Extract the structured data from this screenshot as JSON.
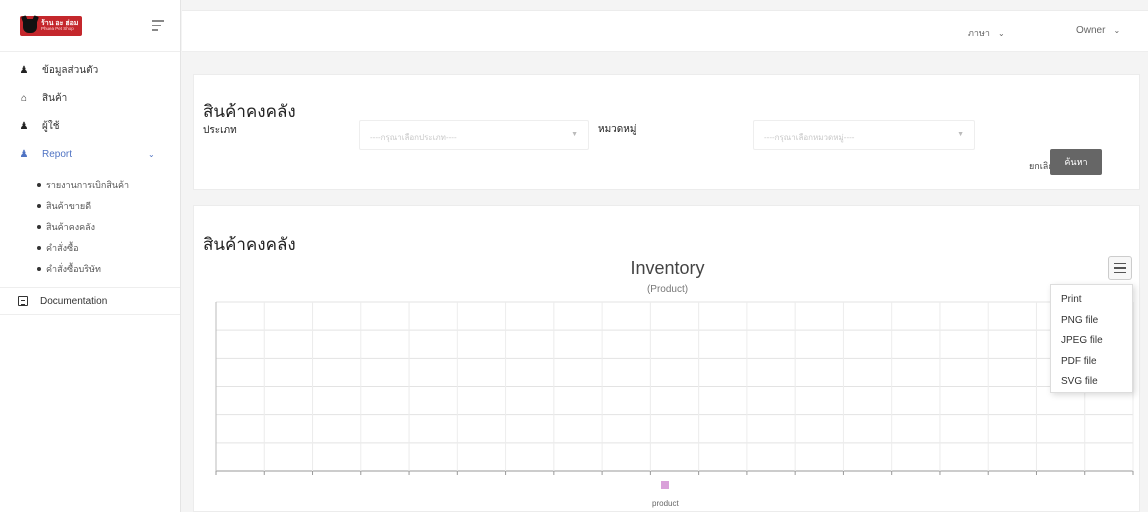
{
  "brand": {
    "logo_line1": "ร้าน อะ ฮ่อม",
    "logo_line2": "Phuea Pet Shop"
  },
  "sidebar": {
    "items": [
      {
        "label": "ข้อมูลส่วนตัว"
      },
      {
        "label": "สินค้า"
      },
      {
        "label": "ผู้ใช้"
      },
      {
        "label": "Report"
      }
    ],
    "report_sub": [
      {
        "label": "รายงานการเบิกสินค้า"
      },
      {
        "label": "สินค้าขายดี"
      },
      {
        "label": "สินค้าคงคลัง"
      },
      {
        "label": "คำสั่งซื้อ"
      },
      {
        "label": "คำสั่งซื้อบริษัท"
      }
    ],
    "doc_label": "Documentation"
  },
  "topbar": {
    "language": "ภาษา",
    "user": "Owner"
  },
  "filter": {
    "title": "สินค้าคงคลัง",
    "type_label": "ประเภท",
    "type_placeholder": "----กรุณาเลือกประเภท----",
    "category_label": "หมวดหมู่",
    "category_placeholder": "----กรุณาเลือกหมวดหมู่----",
    "cancel": "ยกเลิก",
    "search": "ค้นหา"
  },
  "report": {
    "title": "สินค้าคงคลัง",
    "export_menu": [
      "Print",
      "PNG file",
      "JPEG file",
      "PDF file",
      "SVG file"
    ]
  },
  "chart_data": {
    "type": "bar",
    "title": "Inventory",
    "subtitle": "(Product)",
    "categories": [],
    "series": [
      {
        "name": "product",
        "values": [],
        "color": "#d9a0d9"
      }
    ],
    "xlabel": "",
    "ylabel": "",
    "grid": true,
    "legend": "bottom-center"
  },
  "colors": {
    "accent": "#4f73c3",
    "search_button": "#666666",
    "series": "#d9a0d9"
  }
}
